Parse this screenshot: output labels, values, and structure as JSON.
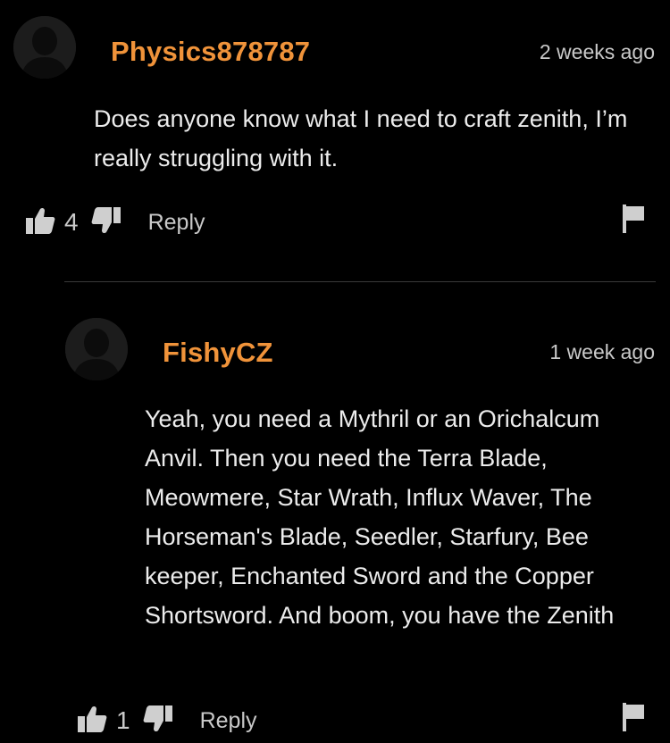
{
  "colors": {
    "background": "#000000",
    "username": "#f0933a",
    "text": "#ececec",
    "muted": "#c9c9c9",
    "divider": "#3a3a3a"
  },
  "comments": [
    {
      "username": "Physics878787",
      "timestamp": "2 weeks ago",
      "body": "Does anyone know what I need to craft zenith, I’m really struggling with it.",
      "likes": "4",
      "reply_label": "Reply",
      "icons": [
        "avatar-placeholder-icon",
        "thumbs-up-icon",
        "thumbs-down-icon",
        "flag-icon"
      ]
    },
    {
      "username": "FishyCZ",
      "timestamp": "1 week ago",
      "body": "Yeah, you need a Mythril or an Orichalcum Anvil. Then you need the Terra Blade, Meowmere, Star Wrath, Influx Waver, The Horseman's Blade, Seedler, Starfury, Bee keeper, Enchanted Sword and the Copper Shortsword. And boom, you have the Zenith",
      "likes": "1",
      "reply_label": "Reply",
      "icons": [
        "avatar-placeholder-icon",
        "thumbs-up-icon",
        "thumbs-down-icon",
        "flag-icon"
      ]
    }
  ]
}
